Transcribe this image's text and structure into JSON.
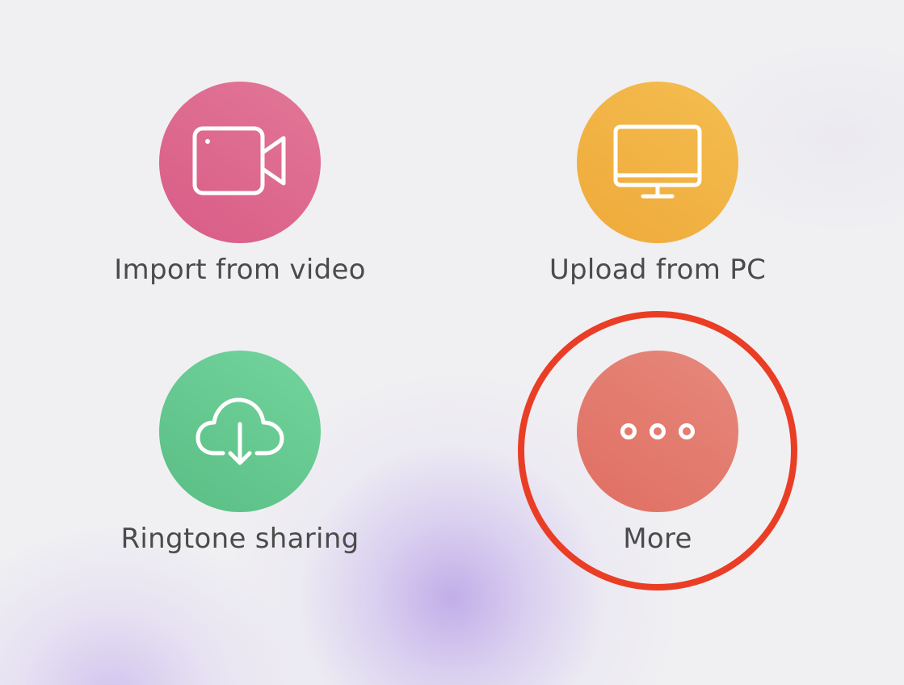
{
  "actions": [
    {
      "label": "Import from video",
      "icon": "video-camera-icon",
      "color_start": "#e27798",
      "color_end": "#d95c86"
    },
    {
      "label": "Upload from PC",
      "icon": "monitor-icon",
      "color_start": "#f4bd50",
      "color_end": "#efaa3a"
    },
    {
      "label": "Ringtone sharing",
      "icon": "cloud-download-icon",
      "color_start": "#73d59d",
      "color_end": "#59bd84"
    },
    {
      "label": "More",
      "icon": "more-dots-icon",
      "color_start": "#e6887c",
      "color_end": "#e06f62"
    }
  ],
  "highlight": {
    "target": "More",
    "color": "#ea3d25"
  }
}
